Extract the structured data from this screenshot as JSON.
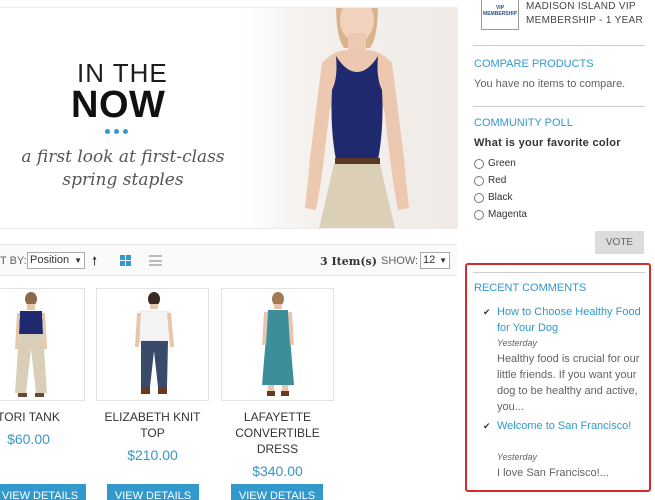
{
  "banner": {
    "headline_line1": "IN THE",
    "headline_line2": "NOW",
    "subtitle": "a first look at first-class spring staples"
  },
  "toolbar": {
    "sort_label": "T BY:",
    "sort_value": "Position",
    "item_count": "3 Item(s)",
    "show_label": "SHOW:",
    "show_value": "12"
  },
  "products": [
    {
      "name": "TORI TANK",
      "price": "$60.00",
      "button": "VIEW DETAILS"
    },
    {
      "name": "ELIZABETH KNIT TOP",
      "price": "$210.00",
      "button": "VIEW DETAILS"
    },
    {
      "name": "LAFAYETTE CONVERTIBLE DRESS",
      "price": "$340.00",
      "rating": "★★★★★",
      "button": "VIEW DETAILS"
    }
  ],
  "sidebar": {
    "mini_product": {
      "thumb_text": "VIP MEMBERSHIP",
      "name": "MADISON ISLAND VIP MEMBERSHIP - 1 YEAR"
    },
    "compare": {
      "title": "COMPARE PRODUCTS",
      "text": "You have no items to compare."
    },
    "poll": {
      "title": "COMMUNITY POLL",
      "question": "What is your favorite color",
      "options": [
        "Green",
        "Red",
        "Black",
        "Magenta"
      ],
      "vote_label": "VOTE"
    },
    "recent_comments": {
      "title": "RECENT COMMENTS",
      "items": [
        {
          "link": "How to Choose Healthy Food for Your Dog",
          "date": "Yesterday",
          "excerpt": "Healthy food is crucial for our little friends. If you want your dog to be healthy and active, you..."
        },
        {
          "link": "Welcome to San Francisco!",
          "date": "Yesterday",
          "excerpt": "I love San Francisco!..."
        }
      ]
    }
  },
  "colors": {
    "accent": "#3399cc",
    "highlight_border": "#d62b2b",
    "vote_button": "#dcdcdc"
  }
}
